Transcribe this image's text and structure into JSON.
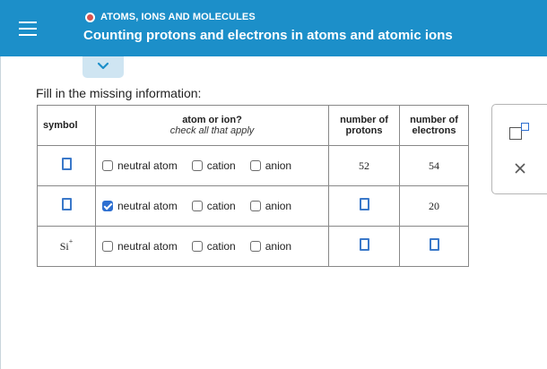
{
  "header": {
    "topic": "ATOMS, IONS AND MOLECULES",
    "title": "Counting protons and electrons in atoms and atomic ions"
  },
  "instructions": "Fill in the missing information:",
  "table": {
    "headers": {
      "symbol": "symbol",
      "atom_or_ion": "atom or ion?",
      "atom_or_ion_hint": "check all that apply",
      "protons_line1": "number of",
      "protons_line2": "protons",
      "electrons_line1": "number of",
      "electrons_line2": "electrons"
    },
    "options": [
      "neutral atom",
      "cation",
      "anion"
    ],
    "rows": [
      {
        "symbol": "",
        "symbol_blank": true,
        "checked": [
          false,
          false,
          false
        ],
        "protons": "52",
        "electrons": "54"
      },
      {
        "symbol": "",
        "symbol_blank": true,
        "checked": [
          true,
          false,
          false
        ],
        "protons": "",
        "protons_blank": true,
        "electrons": "20"
      },
      {
        "symbol": "Si",
        "charge": "+",
        "checked": [
          false,
          false,
          false
        ],
        "protons": "",
        "protons_blank": true,
        "electrons": "",
        "electrons_blank": true
      }
    ]
  },
  "colors": {
    "header_bg": "#1c8fc9",
    "accent": "#2d6fd1",
    "topic_dot": "#d9534f"
  },
  "icons": {
    "menu": "hamburger-icon",
    "collapse": "chevron-down-icon",
    "superscript_tool": "superscript-box-icon",
    "clear": "close-icon"
  }
}
